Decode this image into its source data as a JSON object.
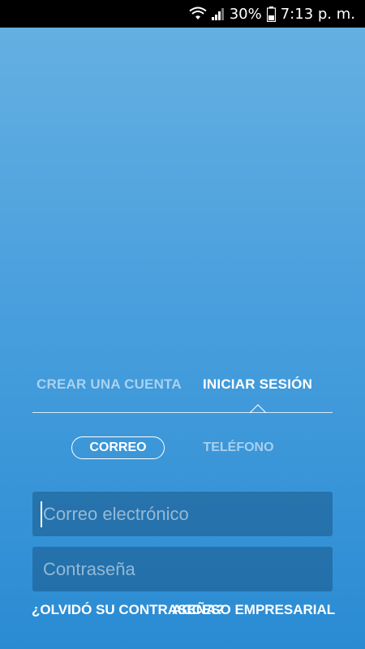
{
  "status_bar": {
    "battery_percent": "30%",
    "time": "7:13 p. m."
  },
  "tabs": {
    "create_account": "CREAR UNA CUENTA",
    "sign_in": "INICIAR SESIÓN"
  },
  "login_method": {
    "email": "CORREO",
    "phone": "TELÉFONO"
  },
  "form": {
    "email_placeholder": "Correo electrónico",
    "password_placeholder": "Contraseña"
  },
  "links": {
    "forgot_password": "¿OLVIDÓ SU CONTRASEÑA?",
    "business_access": "ACCESO EMPRESARIAL"
  }
}
